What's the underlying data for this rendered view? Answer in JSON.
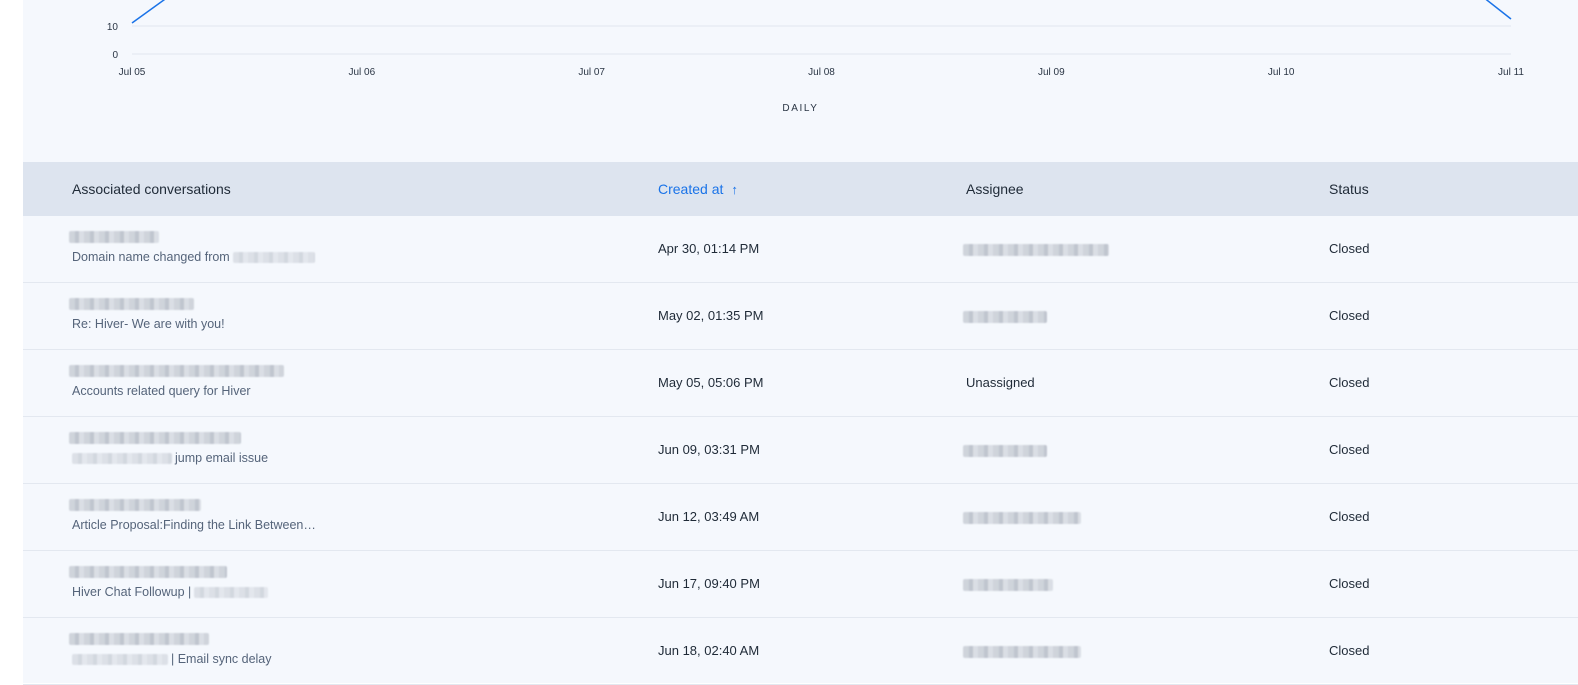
{
  "chart_data": {
    "type": "line",
    "x": [
      "Jul 05",
      "Jul 06",
      "Jul 07",
      "Jul 08",
      "Jul 09",
      "Jul 10",
      "Jul 11"
    ],
    "y_ticks": [
      "0",
      "10"
    ],
    "xlabel": "DAILY",
    "line_color": "#1a73e8"
  },
  "table": {
    "headers": {
      "conversations": "Associated conversations",
      "created_at": "Created at",
      "assignee": "Assignee",
      "status": "Status"
    },
    "sort_arrow": "↑",
    "rows": [
      {
        "subject": "Domain name changed from",
        "subject_suffix": "",
        "created_at": "Apr 30, 01:14 PM",
        "assignee": "",
        "status": "Closed"
      },
      {
        "subject": "Re: Hiver- We are with you!",
        "subject_suffix": "",
        "created_at": "May 02, 01:35 PM",
        "assignee": "",
        "status": "Closed"
      },
      {
        "subject": "Accounts related query for Hiver",
        "subject_suffix": "",
        "created_at": "May 05, 05:06 PM",
        "assignee": "Unassigned",
        "status": "Closed"
      },
      {
        "subject": "",
        "subject_suffix": "jump email issue",
        "created_at": "Jun 09, 03:31 PM",
        "assignee": "",
        "status": "Closed"
      },
      {
        "subject": "Article Proposal:Finding the Link Between…",
        "subject_suffix": "",
        "created_at": "Jun 12, 03:49 AM",
        "assignee": "",
        "status": "Closed"
      },
      {
        "subject": "Hiver Chat Followup |",
        "subject_suffix": "",
        "created_at": "Jun 17, 09:40 PM",
        "assignee": "",
        "status": "Closed"
      },
      {
        "subject": "",
        "subject_suffix": "| Email sync delay",
        "created_at": "Jun 18, 02:40 AM",
        "assignee": "",
        "status": "Closed"
      }
    ]
  }
}
